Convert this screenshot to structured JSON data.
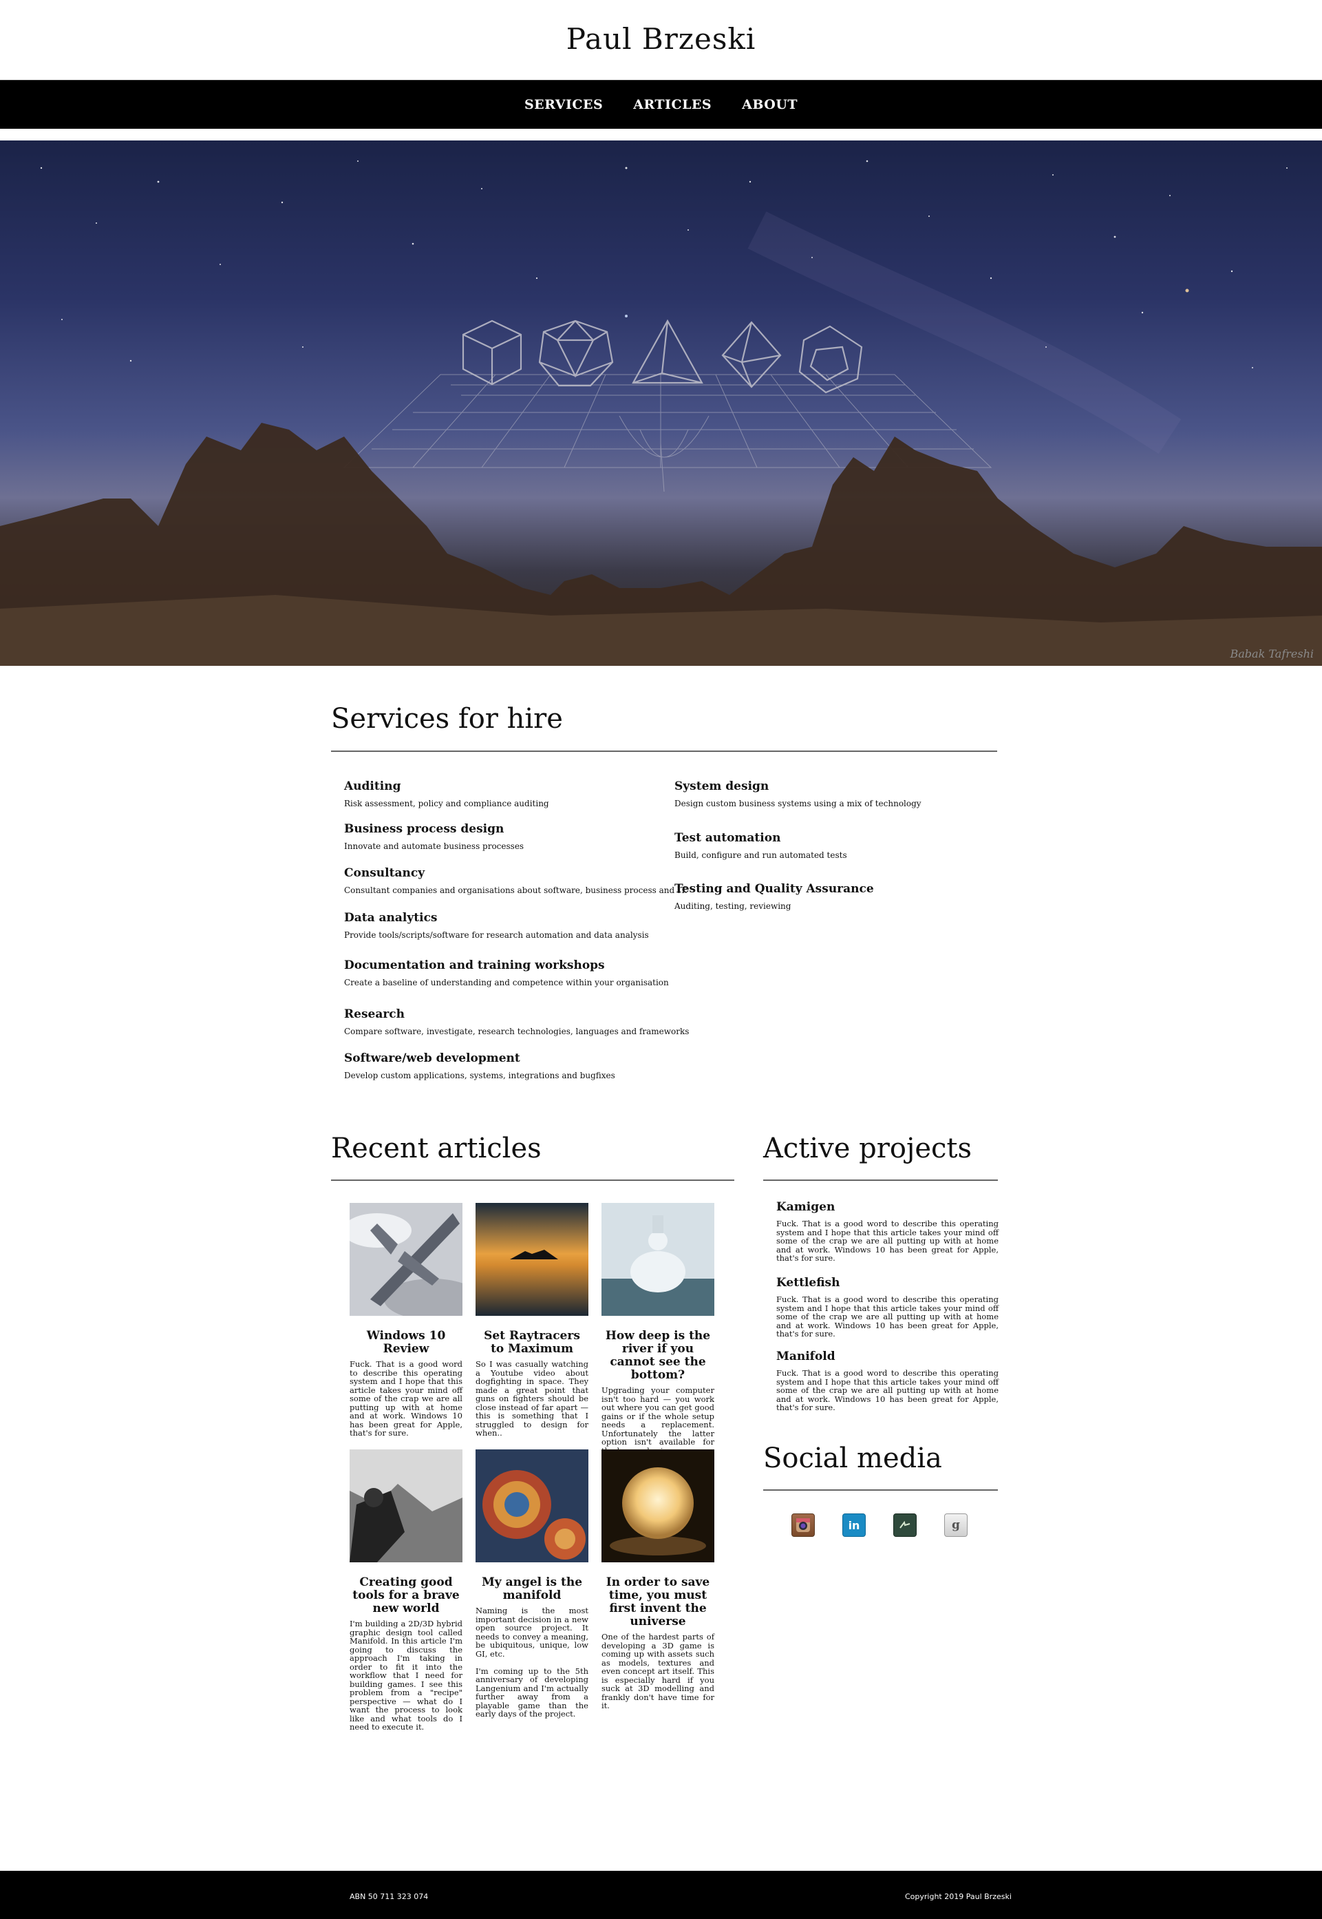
{
  "site": {
    "title": "Paul Brzeski"
  },
  "nav": {
    "items": [
      "SERVICES",
      "ARTICLES",
      "ABOUT"
    ]
  },
  "hero": {
    "credit": "Babak Tafreshi"
  },
  "services": {
    "heading": "Services for hire",
    "left": [
      {
        "title": "Auditing",
        "desc": "Risk assessment, policy and compliance auditing"
      },
      {
        "title": "Business process design",
        "desc": "Innovate and automate business processes"
      },
      {
        "title": "Consultancy",
        "desc": "Consultant companies and organisations about software, business process and IT."
      },
      {
        "title": "Data analytics",
        "desc": "Provide tools/scripts/software for research automation and data analysis"
      },
      {
        "title": "Documentation and training workshops",
        "desc": "Create a baseline of understanding and competence within your organisation"
      },
      {
        "title": "Research",
        "desc": "Compare software, investigate, research technologies, languages and frameworks"
      },
      {
        "title": "Software/web development",
        "desc": "Develop custom applications, systems, integrations and bugfixes"
      }
    ],
    "right": [
      {
        "title": "System design",
        "desc": "Design custom business systems using a mix of technology"
      },
      {
        "title": "Test automation",
        "desc": "Build, configure and run automated tests"
      },
      {
        "title": "Testing and Quality Assurance",
        "desc": "Auditing, testing, reviewing"
      }
    ]
  },
  "articles": {
    "heading": "Recent articles",
    "items": [
      {
        "title": "Windows 10 Review",
        "body": "Fuck. That is a good word to describe this operating system and I hope that this article takes your mind off some of the crap we are all putting up with at home and at work. Windows 10 has been great for Apple, that's for sure."
      },
      {
        "title": "Set Raytracers to Maximum",
        "body": "So I was casually watching a Youtube video about dogfighting in space. They made a great point that guns on fighters should be close instead of far apart — this is something that I struggled to design for when.."
      },
      {
        "title": "How deep is the river if you cannot see the bottom?",
        "body": "Upgrading your computer isn't too hard — you work out where you can get good gains or if the whole setup needs a replacement. Unfortunately the latter option isn't available for the human brain."
      },
      {
        "title": "Creating good tools for a brave new world",
        "body": "I'm building a 2D/3D hybrid graphic design tool called Manifold. In this article I'm going to discuss the approach I'm taking in order to fit it into the workflow that I need for building games. I see this problem from a \"recipe\" perspective — what do I want the process to look like and what tools do I need to execute it."
      },
      {
        "title": "My angel is the manifold",
        "body": "Naming is the most important decision in a new open source project. It needs to convey a meaning, be ubiquitous, unique, low GI, etc.\n\nI'm coming up to the 5th anniversary of developing Langenium and I'm actually further away from a playable game than the early days of the project."
      },
      {
        "title": "In order to save time, you must first invent the universe",
        "body": "One of the hardest parts of developing a 3D game is coming up with assets such as models, textures and even concept art itself. This is especially hard if you suck at 3D modelling and frankly don't have time for it."
      }
    ]
  },
  "projects": {
    "heading": "Active projects",
    "items": [
      {
        "title": "Kamigen",
        "body": "Fuck. That is a good word to describe this operating system and I hope that this article takes your mind off some of the crap we are all putting up with at home and at work. Windows 10 has been great for Apple, that's for sure."
      },
      {
        "title": "Kettlefish",
        "body": "Fuck. That is a good word to describe this operating system and I hope that this article takes your mind off some of the crap we are all putting up with at home and at work. Windows 10 has been great for Apple, that's for sure."
      },
      {
        "title": "Manifold",
        "body": "Fuck. That is a good word to describe this operating system and I hope that this article takes your mind off some of the crap we are all putting up with at home and at work. Windows 10 has been great for Apple, that's for sure."
      }
    ]
  },
  "social": {
    "heading": "Social media",
    "icons": [
      "instagram-icon",
      "linkedin-icon",
      "deviantart-icon",
      "google-icon"
    ],
    "linkedin_glyph": "in",
    "google_glyph": "g"
  },
  "footer": {
    "abn": "ABN 50 711 323 074",
    "copyright": "Copyright 2019 Paul Brzeski"
  }
}
